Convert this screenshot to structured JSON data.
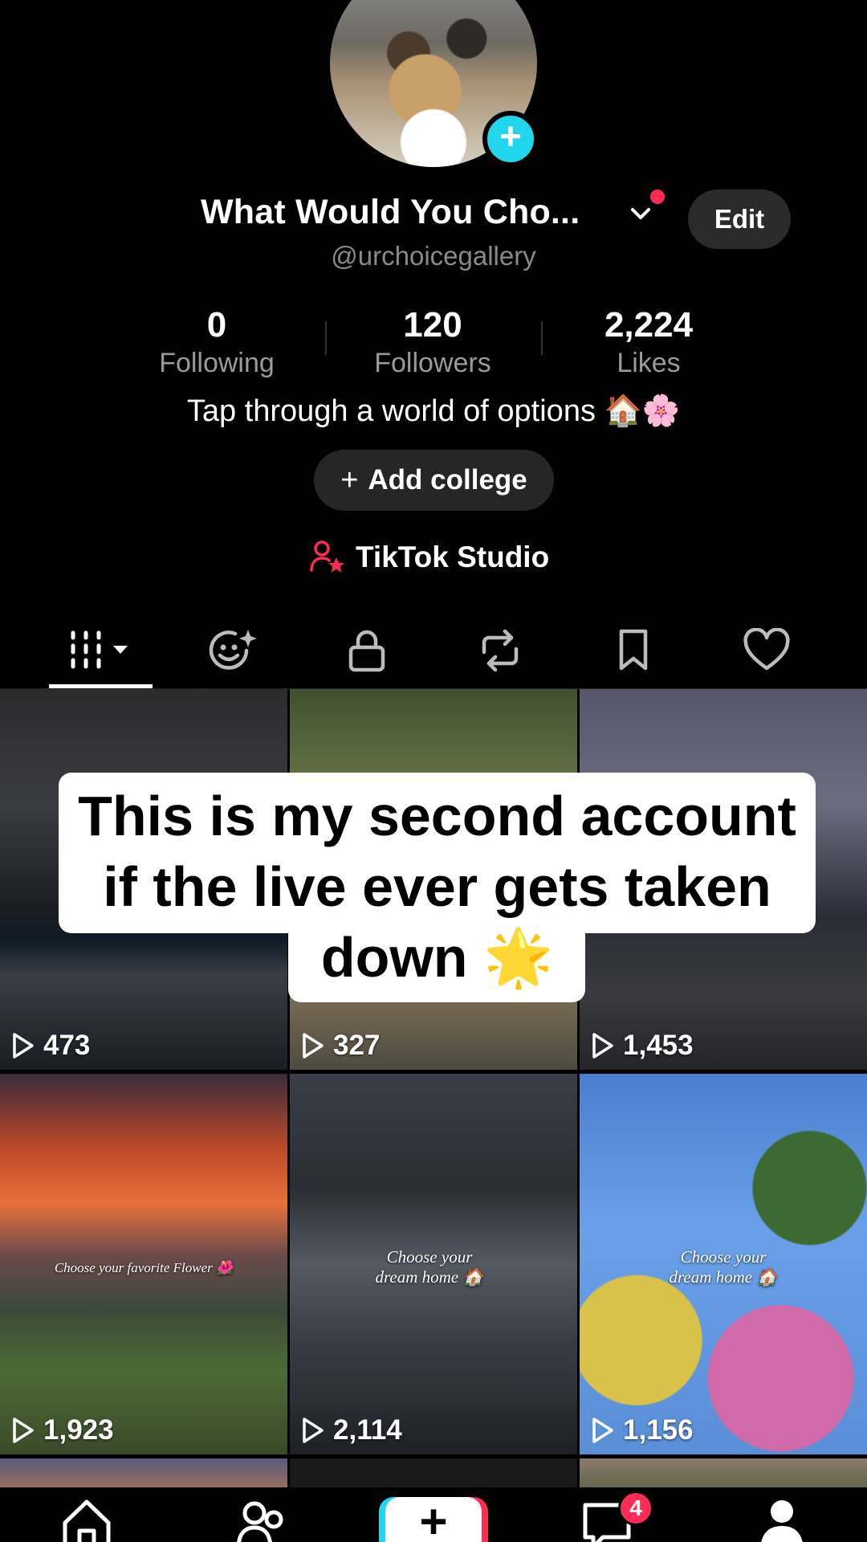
{
  "profile": {
    "display_name": "What Would You Cho...",
    "handle": "@urchoicegallery",
    "edit_label": "Edit",
    "bio": "Tap through a world of options 🏠🌸",
    "add_college_label": "Add college",
    "add_college_icon": "plus-icon",
    "studio_label": "TikTok Studio",
    "studio_icon": "person-star-icon",
    "accent_color": "#fe2c55",
    "avatar_add_color": "#20d5ec"
  },
  "stats": [
    {
      "value": "0",
      "label": "Following"
    },
    {
      "value": "120",
      "label": "Followers"
    },
    {
      "value": "2,224",
      "label": "Likes"
    }
  ],
  "tabs": [
    {
      "name": "videos",
      "icon": "grid-icon",
      "active": true
    },
    {
      "name": "reposts-ai",
      "icon": "face-sparkle-icon"
    },
    {
      "name": "private",
      "icon": "lock-icon"
    },
    {
      "name": "reposts",
      "icon": "repost-icon"
    },
    {
      "name": "saved",
      "icon": "bookmark-icon"
    },
    {
      "name": "liked",
      "icon": "heart-icon"
    }
  ],
  "videos": [
    {
      "views": "473"
    },
    {
      "views": "327"
    },
    {
      "views": "1,453"
    },
    {
      "views": "1,923",
      "caption": "Choose your favorite Flower 🌺"
    },
    {
      "views": "2,114",
      "caption": "Choose your dream home 🏠"
    },
    {
      "views": "1,156",
      "caption": "Choose your dream home 🏠"
    }
  ],
  "overlay": {
    "text": "This is my second account if the live ever gets taken down 🌟"
  },
  "bottom_nav": {
    "items": [
      "home-icon",
      "friends-icon",
      "create-icon",
      "inbox-icon",
      "profile-icon"
    ],
    "inbox_badge": "4",
    "create_label": "+"
  }
}
